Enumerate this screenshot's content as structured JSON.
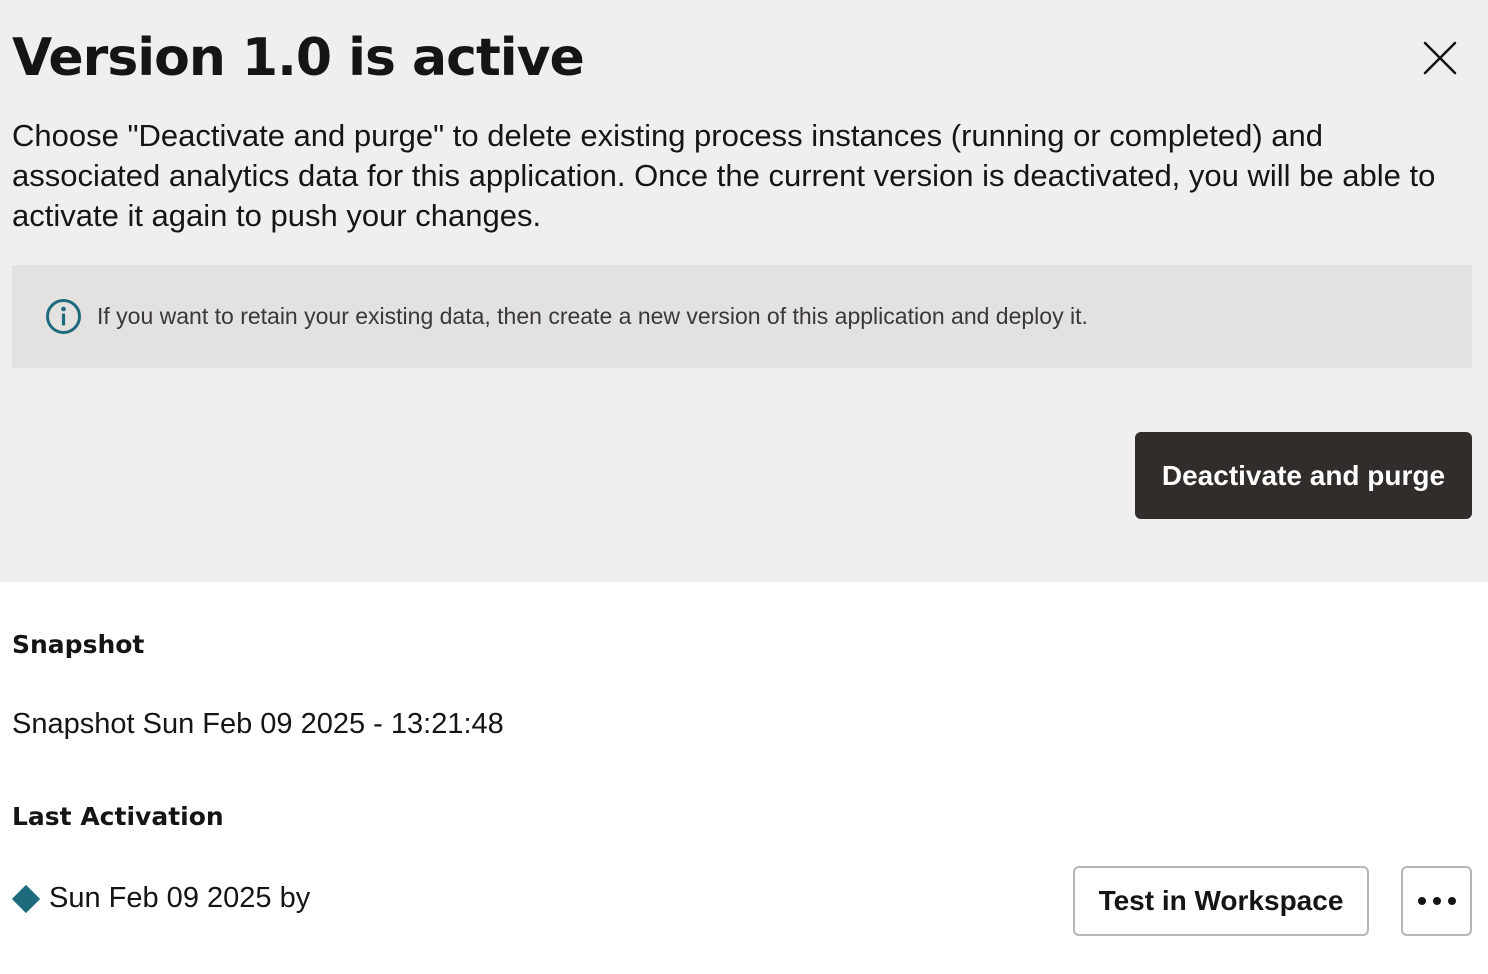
{
  "dialog": {
    "title": "Version 1.0 is active",
    "description": "Choose \"Deactivate and purge\" to delete existing process instances (running or completed) and associated analytics data for this application. Once the current version is deactivated, you will be able to activate it again to push your changes.",
    "info_banner": {
      "icon": "info-icon",
      "text": "If you want to retain your existing data, then create a new version of this application and deploy it."
    },
    "primary_button": "Deactivate and purge",
    "close_icon": "close-icon"
  },
  "details": {
    "snapshot_label": "Snapshot",
    "snapshot_value": "Snapshot Sun Feb 09 2025 - 13:21:48",
    "last_activation_label": "Last Activation",
    "last_activation_value": "Sun Feb 09 2025 by",
    "status_icon": "diamond-icon",
    "test_button": "Test in Workspace",
    "more_icon": "more-options-icon"
  },
  "colors": {
    "panel_background": "#f1efed",
    "banner_background": "#e4e2e0",
    "primary_button": "#312d2a",
    "info_accent": "#1e6b7d",
    "status_diamond": "#1e6b7d"
  }
}
